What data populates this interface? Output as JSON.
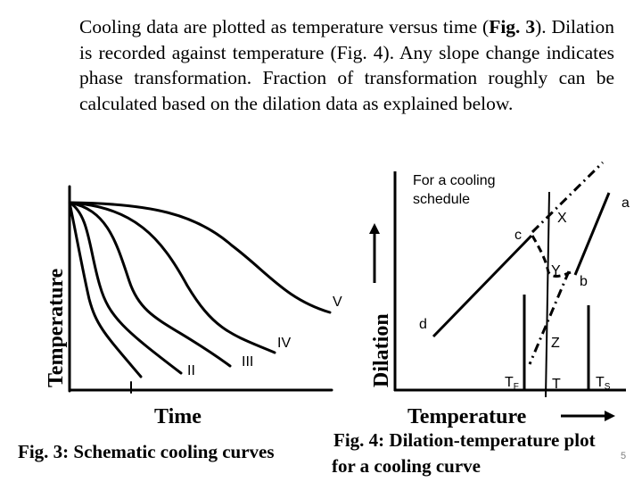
{
  "intro": {
    "part1": "Cooling data are plotted as temperature versus time (",
    "fig3_ref": "Fig. 3",
    "part2": "). Dilation is recorded against temperature (Fig. 4). Any slope change indicates phase transformation. Fraction of transformation roughly can be calculated based on the dilation data as explained below."
  },
  "fig3": {
    "ylabel": "Temperature",
    "xlabel": "Time",
    "caption": "Fig. 3: Schematic cooling curves",
    "curves": [
      {
        "label": "I"
      },
      {
        "label": "II"
      },
      {
        "label": "III"
      },
      {
        "label": "IV"
      },
      {
        "label": "V"
      }
    ]
  },
  "fig4": {
    "ylabel": "Dilation",
    "xlabel": "Temperature",
    "caption_line1": "Fig. 4: Dilation-temperature plot",
    "caption_line2": "for a cooling curve",
    "note_line1": "For a cooling",
    "note_line2": "schedule",
    "point_labels": {
      "a": "a",
      "b": "b",
      "c": "c",
      "d": "d",
      "X": "X",
      "Y": "Y",
      "Z": "Z"
    },
    "temp_labels": {
      "TF_main": "T",
      "TF_sub": "F",
      "T": "T",
      "TS_main": "T",
      "TS_sub": "S"
    }
  },
  "slide_number": "5",
  "colors": {
    "ink": "#000000",
    "slide_number": "#808080",
    "background": "#ffffff"
  }
}
